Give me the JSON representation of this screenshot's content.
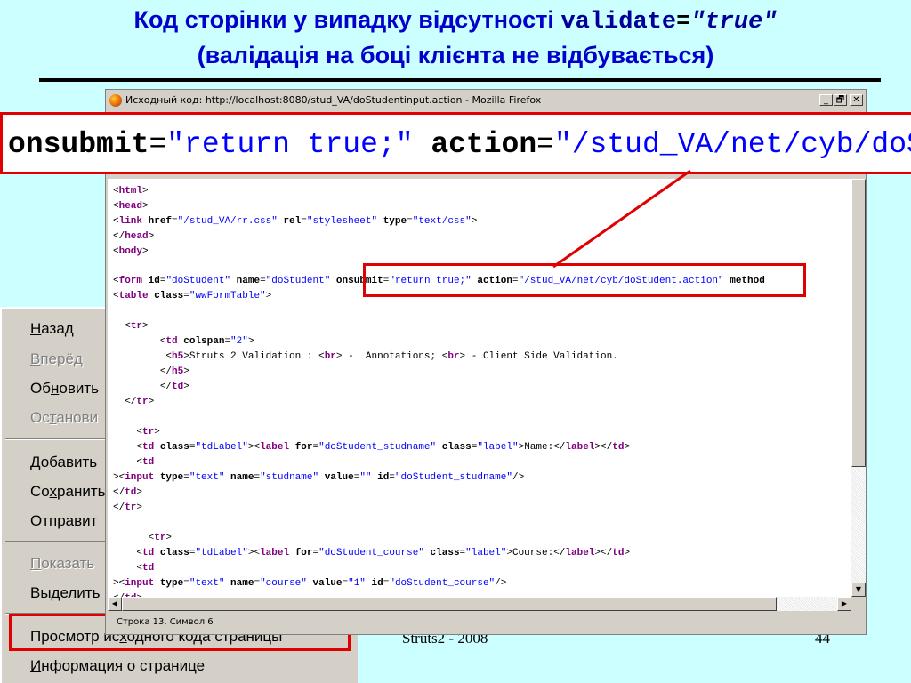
{
  "slide": {
    "title_part1": "Код сторінки у випадку відсутності ",
    "title_code": "validate",
    "title_eq": "=",
    "title_value": "\"true\"",
    "title_line2": "(валідація на боці клієнта не відбувається)",
    "footer_left": "Struts2  - 2008",
    "footer_right": "44"
  },
  "zoom": {
    "attr1": "onsubmit",
    "eq1": "=",
    "val1": "\"return true;\"",
    "sp": " ",
    "attr2": "action",
    "eq2": "=",
    "val2": "\"/stud_VA/net/cyb/doStude"
  },
  "window": {
    "title": "Исходный код: http://localhost:8080/stud_VA/doStudentinput.action - Mozilla Firefox",
    "min_label": "_",
    "max_label": "🗗",
    "close_label": "✕",
    "status": "Строка 13, Символ 6",
    "colors": {
      "tag": "#800080",
      "value": "#0000ff",
      "highlight": "#e00000"
    }
  },
  "code": {
    "l1": {
      "open": "<",
      "tag": "html",
      "close": ">"
    },
    "l2": {
      "open": "<",
      "tag": "head",
      "close": ">"
    },
    "l3": {
      "open": "<",
      "tag": "link",
      "a1": " href",
      "v1": "\"/stud_VA/rr.css\"",
      "a2": " rel",
      "v2": "\"stylesheet\"",
      "a3": " type",
      "v3": "\"text/css\"",
      "close": ">"
    },
    "l4": {
      "open": "</",
      "tag": "head",
      "close": ">"
    },
    "l5": {
      "open": "<",
      "tag": "body",
      "close": ">"
    },
    "l6": {
      "open": "<",
      "tag": "form",
      "a1": " id",
      "v1": "\"doStudent\"",
      "a2": " name",
      "v2": "\"doStudent\"",
      "a3": " onsubmit",
      "v3": "\"return true;\"",
      "a4": " action",
      "v4": "\"/stud_VA/net/cyb/doStudent.action\"",
      "a5": " method"
    },
    "l7": {
      "open": "<",
      "tag": "table",
      "a1": " class",
      "v1": "\"wwFormTable\"",
      "close": ">"
    },
    "l8": {
      "indent": "  ",
      "open": "<",
      "tag": "tr",
      "close": ">"
    },
    "l9": {
      "indent": "        ",
      "open": "<",
      "tag": "td",
      "a1": " colspan",
      "v1": "\"2\"",
      "close": ">"
    },
    "l10": {
      "indent": "         ",
      "open": "<",
      "tag": "h5",
      "close": ">",
      "text": "Struts 2 Validation : ",
      "o2": "<",
      "tag2": "br",
      "c2": ">",
      "text2": " -  Annotations; ",
      "o3": "<",
      "tag3": "br",
      "c3": ">",
      "text3": " - Client Side Validation."
    },
    "l11": {
      "indent": "        ",
      "open": "</",
      "tag": "h5",
      "close": ">"
    },
    "l12": {
      "indent": "        ",
      "open": "</",
      "tag": "td",
      "close": ">"
    },
    "l13": {
      "indent": "  ",
      "open": "</",
      "tag": "tr",
      "close": ">"
    },
    "l14": {
      "indent": "    ",
      "open": "<",
      "tag": "tr",
      "close": ">"
    },
    "l15": {
      "indent": "    ",
      "open": "<",
      "tag": "td",
      "a1": " class",
      "v1": "\"tdLabel\"",
      "close": ">",
      "o2": "<",
      "tag2": "label",
      "a2": " for",
      "v2": "\"doStudent_studname\"",
      "a3": " class",
      "v3": "\"label\"",
      "c2": ">",
      "text": "Name:",
      "o3": "</",
      "tag3": "label",
      "c3": ">",
      "o4": "</",
      "tag4": "td",
      "c4": ">"
    },
    "l16": {
      "indent": "    ",
      "open": "<",
      "tag": "td"
    },
    "l17": {
      "open": "><",
      "tag": "input",
      "a1": " type",
      "v1": "\"text\"",
      "a2": " name",
      "v2": "\"studname\"",
      "a3": " value",
      "v3": "\"\"",
      "a4": " id",
      "v4": "\"doStudent_studname\"",
      "close": "/>"
    },
    "l18": {
      "open": "</",
      "tag": "td",
      "close": ">"
    },
    "l19": {
      "open": "</",
      "tag": "tr",
      "close": ">"
    },
    "l20": {
      "indent": "      ",
      "open": "<",
      "tag": "tr",
      "close": ">"
    },
    "l21": {
      "indent": "    ",
      "open": "<",
      "tag": "td",
      "a1": " class",
      "v1": "\"tdLabel\"",
      "close": ">",
      "o2": "<",
      "tag2": "label",
      "a2": " for",
      "v2": "\"doStudent_course\"",
      "a3": " class",
      "v3": "\"label\"",
      "c2": ">",
      "text": "Course:",
      "o3": "</",
      "tag3": "label",
      "c3": ">",
      "o4": "</",
      "tag4": "td",
      "c4": ">"
    },
    "l22": {
      "indent": "    ",
      "open": "<",
      "tag": "td"
    },
    "l23": {
      "open": "><",
      "tag": "input",
      "a1": " type",
      "v1": "\"text\"",
      "a2": " name",
      "v2": "\"course\"",
      "a3": " value",
      "v3": "\"1\"",
      "a4": " id",
      "v4": "\"doStudent_course\"",
      "close": "/>"
    },
    "l24": {
      "open": "</",
      "tag": "td",
      "close": ">"
    }
  },
  "context_menu": {
    "back": {
      "pre": "",
      "u": "Н",
      "post": "азад"
    },
    "forward": {
      "pre": "",
      "u": "В",
      "post": "перёд"
    },
    "reload": {
      "pre": "Об",
      "u": "н",
      "post": "овить"
    },
    "stop": {
      "pre": "Ос",
      "u": "т",
      "post": "анови"
    },
    "bookmark": {
      "pre": "",
      "u": "Д",
      "post": "обавить"
    },
    "save": {
      "pre": "Со",
      "u": "х",
      "post": "ранить"
    },
    "send": {
      "pre": "Отправит",
      "u": "",
      "post": ""
    },
    "show": {
      "pre": "",
      "u": "П",
      "post": "оказать"
    },
    "select": {
      "pre": "Выделить",
      "u": "",
      "post": ""
    },
    "view_source": {
      "pre": "Просмотр ис",
      "u": "х",
      "post": "одного кода страницы"
    },
    "page_info": {
      "pre": "",
      "u": "И",
      "post": "нформация о странице"
    }
  }
}
